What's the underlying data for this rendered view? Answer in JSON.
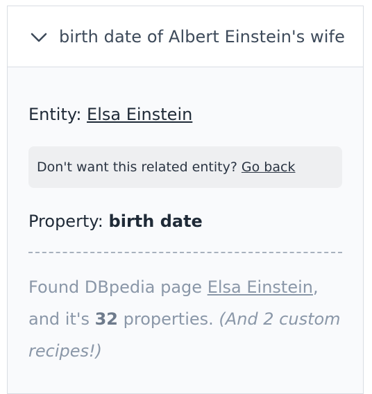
{
  "header": {
    "query": "birth date of Albert Einstein's wife"
  },
  "entity": {
    "label": "Entity:",
    "name": "Elsa Einstein"
  },
  "notice": {
    "text": "Don't want this related entity?",
    "link": "Go back"
  },
  "property": {
    "label": "Property:",
    "name": "birth date"
  },
  "found": {
    "prefix": "Found DBpedia page",
    "page": "Elsa Einstein",
    "middle": ", and it's",
    "count": "32",
    "suffix": "properties.",
    "note": "(And 2 custom recipes!)"
  },
  "colors": {
    "text": "#1f2a37",
    "muted": "#8a97a8",
    "border": "#d9dde3",
    "panel_bg": "#f9fafc",
    "notice_bg": "#eeeff1"
  }
}
